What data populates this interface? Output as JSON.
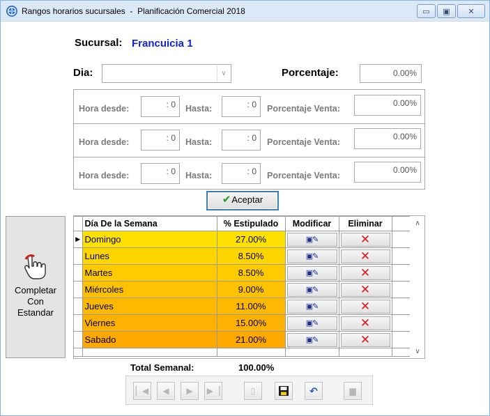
{
  "window": {
    "title": "Rangos horarios sucursales  -  Planificación Comercial 2018",
    "icon": "gear-globe-icon",
    "controls": [
      "minimize",
      "maximize",
      "close"
    ]
  },
  "header": {
    "sucursal_label": "Sucursal:",
    "sucursal_value": "Francuicia 1",
    "dia_label": "Dia:",
    "dia_value": "",
    "porcentaje_label": "Porcentaje:",
    "porcentaje_value": "0.00%"
  },
  "ranges": [
    {
      "hora_desde_label": "Hora desde:",
      "hora_desde": ": 0",
      "hasta_label": "Hasta:",
      "hasta": ": 0",
      "venta_label": "Porcentaje Venta:",
      "venta": "0.00%"
    },
    {
      "hora_desde_label": "Hora desde:",
      "hora_desde": ": 0",
      "hasta_label": "Hasta:",
      "hasta": ": 0",
      "venta_label": "Porcentaje Venta:",
      "venta": "0.00%"
    },
    {
      "hora_desde_label": "Hora desde:",
      "hora_desde": ": 0",
      "hasta_label": "Hasta:",
      "hasta": ": 0",
      "venta_label": "Porcentaje Venta:",
      "venta": "0.00%"
    }
  ],
  "aceptar_label": "Aceptar",
  "completar_label": "Completar Con Estandar",
  "grid": {
    "columns": [
      "Día De la Semana",
      "% Estipulado",
      "Modificar",
      "Eliminar"
    ],
    "rows": [
      {
        "day": "Domingo",
        "pct": "27.00%",
        "color": "#ffe100",
        "selected": true
      },
      {
        "day": "Lunes",
        "pct": "8.50%",
        "color": "#ffd500",
        "selected": false
      },
      {
        "day": "Martes",
        "pct": "8.50%",
        "color": "#ffcb00",
        "selected": false
      },
      {
        "day": "Miércoles",
        "pct": "9.00%",
        "color": "#ffc200",
        "selected": false
      },
      {
        "day": "Jueves",
        "pct": "11.00%",
        "color": "#ffb900",
        "selected": false
      },
      {
        "day": "Viernes",
        "pct": "15.00%",
        "color": "#ffb100",
        "selected": false
      },
      {
        "day": "Sabado",
        "pct": "21.00%",
        "color": "#ffa800",
        "selected": false
      }
    ]
  },
  "total": {
    "label": "Total Semanal:",
    "value": "100.00%"
  },
  "navigator": {
    "buttons": [
      "first",
      "prior",
      "next",
      "last",
      "insert",
      "post",
      "cancel",
      "delete"
    ]
  }
}
